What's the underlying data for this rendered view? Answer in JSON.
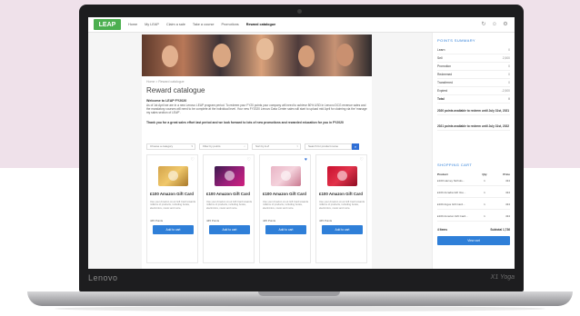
{
  "device": {
    "brand": "Lenovo",
    "model": "X1 Yoga"
  },
  "colors": {
    "accent": "#2f7fd8",
    "logo_bg": "#4caf50",
    "background_band": "#efe1ea"
  },
  "nav": {
    "logo": "LEAP",
    "items": [
      {
        "label": "Home",
        "active": false
      },
      {
        "label": "My LEAP",
        "active": false
      },
      {
        "label": "Claim a sale",
        "active": false
      },
      {
        "label": "Take a course",
        "active": false
      },
      {
        "label": "Promotions",
        "active": false
      },
      {
        "label": "Reward catalogue",
        "active": true
      }
    ],
    "icons": [
      "refresh-icon",
      "user-icon",
      "settings-icon"
    ]
  },
  "page": {
    "breadcrumb": "Home > Reward catalogue",
    "title": "Reward catalogue",
    "welcome": "Welcome to LEAP FY2020",
    "intro": "As of 1st April we are in a new Lenovo LEAP program period. To redeem your FY20 points your company will need to achieve 80% USD in Lenovo DCG revenue sales and the mandatory courses will need to be complete at the individual level. Your new FY2020 Lenovo Data Center sales will start to upload mid April for claiming via the 'manage my sales section of LEAP'.",
    "thanks": "Thank you for a great sales effort last period and we look forward to lots of new promotions and rewarded education for you in FY2020"
  },
  "filters": {
    "category": "Choose a category",
    "points": "Filter by points",
    "sort": "Sort by A-Z",
    "search_placeholder": "Search for product name"
  },
  "products": [
    {
      "title": "£100 Amazon Gift Card",
      "description": "Use your Amazon.co.uk Gift Card towards millions of products, including books, electronics, music and more.",
      "points": "445 Points",
      "button": "Add to cart",
      "favorited": false
    },
    {
      "title": "£100 Amazon Gift Card",
      "description": "Use your Amazon.co.uk Gift Card towards millions of products, including books, electronics, music and more.",
      "points": "445 Points",
      "button": "Add to cart",
      "favorited": false
    },
    {
      "title": "£100 Amazon Gift Card",
      "description": "Use your Amazon.co.uk Gift Card towards millions of products, including books, electronics, music and more.",
      "points": "445 Points",
      "button": "Add to cart",
      "favorited": true
    },
    {
      "title": "£100 Amazon Gift Card",
      "description": "Use your Amazon.co.uk Gift Card towards millions of products, including books, electronics, music and more.",
      "points": "445 Points",
      "button": "Add to cart",
      "favorited": false
    }
  ],
  "points_summary": {
    "heading": "POINTS SUMMARY",
    "rows": [
      {
        "label": "Learn",
        "value": "0"
      },
      {
        "label": "Sell",
        "value": "2,500"
      },
      {
        "label": "Promotion",
        "value": "0"
      },
      {
        "label": "Redeemed",
        "value": "0"
      },
      {
        "label": "Transferred",
        "value": "0"
      },
      {
        "label": "Expired",
        "value": "-2,500"
      },
      {
        "label": "Total",
        "value": "0"
      }
    ],
    "note1": "2020 points available to redeem until July 31st, 2021",
    "note2": "2021 points available to redeem until July 31st, 2022"
  },
  "cart": {
    "heading": "SHOPPING CART",
    "col_product": "Product",
    "col_qty": "Qty",
    "col_price": "Price",
    "rows": [
      {
        "product": "£100 Harvey Nichols...",
        "qty": "1",
        "price": "434"
      },
      {
        "product": "£100 Arcadia Gift Vou...",
        "qty": "1",
        "price": "434"
      },
      {
        "product": "£100 Argos Gift Card...",
        "qty": "1",
        "price": "434"
      },
      {
        "product": "£100 Amazon Gift Card...",
        "qty": "1",
        "price": "434"
      }
    ],
    "items_label": "4 Items",
    "subtotal_label": "Subtotal",
    "subtotal_value": "1,736",
    "view_button": "View cart"
  }
}
